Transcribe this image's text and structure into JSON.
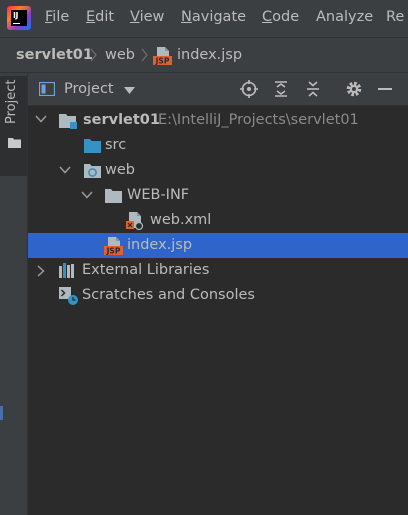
{
  "menu": {
    "items": [
      {
        "mnemonic": "F",
        "rest": "ile"
      },
      {
        "mnemonic": "E",
        "rest": "dit"
      },
      {
        "mnemonic": "V",
        "rest": "iew"
      },
      {
        "mnemonic": "N",
        "rest": "avigate"
      },
      {
        "mnemonic": "C",
        "rest": "ode"
      },
      {
        "mnemonic": "",
        "rest": "Analyze"
      },
      {
        "mnemonic": "",
        "rest": "Re"
      }
    ]
  },
  "breadcrumb": {
    "project": "servlet01",
    "folder": "web",
    "file": "index.jsp"
  },
  "side_strip": {
    "tab_label": "Project"
  },
  "panel": {
    "title": "Project"
  },
  "tree": {
    "root": {
      "label": "servlet01",
      "path": "E:\\IntelliJ_Projects\\servlet01"
    },
    "src": "src",
    "web": "web",
    "web_inf": "WEB-INF",
    "web_xml": "web.xml",
    "index_jsp": "index.jsp",
    "external_libraries": "External Libraries",
    "scratches": "Scratches and Consoles"
  },
  "colors": {
    "selection": "#2f65ca",
    "folder_blue": "#3592c4",
    "folder_gray": "#aeb9c0",
    "jsp_orange": "#e0602f"
  }
}
